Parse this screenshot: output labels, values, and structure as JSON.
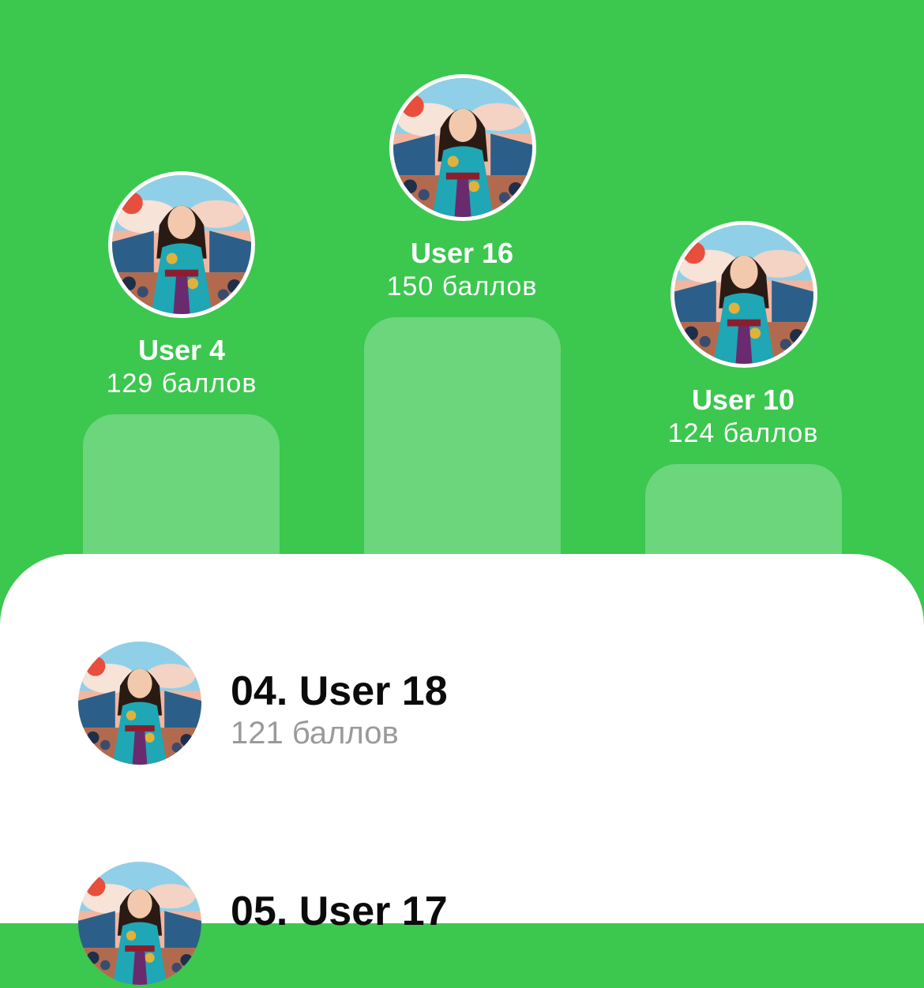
{
  "podium": [
    {
      "place": 2,
      "name": "User 4",
      "points": "129 баллов",
      "avatar": "user-portrait-avatar"
    },
    {
      "place": 1,
      "name": "User 16",
      "points": "150 баллов",
      "avatar": "user-portrait-avatar"
    },
    {
      "place": 3,
      "name": "User 10",
      "points": "124 баллов",
      "avatar": "user-portrait-avatar"
    }
  ],
  "list": [
    {
      "title": "04. User 18",
      "points": "121 баллов",
      "avatar": "user-portrait-avatar"
    },
    {
      "title": "05. User 17",
      "points": "",
      "avatar": "user-portrait-avatar"
    }
  ],
  "colors": {
    "background": "#3cc74f",
    "podium_bar": "#6bd67b",
    "sheet": "#ffffff",
    "secondary_text": "#9a9a9a"
  }
}
